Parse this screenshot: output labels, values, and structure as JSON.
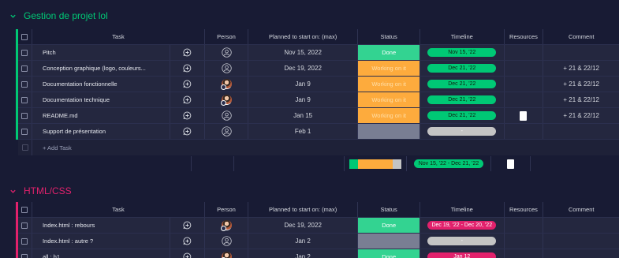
{
  "groups": [
    {
      "title": "Gestion de projet lol",
      "color": "#00c875",
      "headers": {
        "task": "Task",
        "person": "Person",
        "planned": "Planned to start on: (max)",
        "status": "Status",
        "timeline": "Timeline",
        "resources": "Resources",
        "comment": "Comment"
      },
      "rows": [
        {
          "task": "Pitch",
          "person": "empty",
          "planned": "Nov 15, 2022",
          "status": "Done",
          "status_kind": "done",
          "timeline": "Nov 15, '22",
          "timeline_kind": "green",
          "resource": false,
          "comment": ""
        },
        {
          "task": "Conception graphique (logo, couleurs...",
          "person": "empty",
          "planned": "Dec 19, 2022",
          "status": "Working on it",
          "status_kind": "work",
          "timeline": "Dec 21, '22",
          "timeline_kind": "green",
          "resource": false,
          "comment": "+ 21 & 22/12"
        },
        {
          "task": "Documentation fonctionnelle",
          "person": "photo",
          "planned": "Jan 9",
          "status": "Working on it",
          "status_kind": "work",
          "timeline": "Dec 21, '22",
          "timeline_kind": "green",
          "resource": false,
          "comment": "+ 21 & 22/12"
        },
        {
          "task": "Documentation technique",
          "person": "photo",
          "planned": "Jan 9",
          "status": "Working on it",
          "status_kind": "work",
          "timeline": "Dec 21, '22",
          "timeline_kind": "green",
          "resource": false,
          "comment": "+ 21 & 22/12"
        },
        {
          "task": "README.md",
          "person": "empty",
          "planned": "Jan 15",
          "status": "Working on it",
          "status_kind": "work",
          "timeline": "Dec 21, '22",
          "timeline_kind": "green",
          "resource": true,
          "comment": "+ 21 & 22/12"
        },
        {
          "task": "Support de présentation",
          "person": "empty",
          "planned": "Feb 1",
          "status": "",
          "status_kind": "empty",
          "timeline": "-",
          "timeline_kind": "grey",
          "resource": false,
          "comment": ""
        }
      ],
      "add_task": "+ Add Task",
      "summary_timeline": "Nov 15, '22 - Dec 21, '22",
      "summary_progress": {
        "done": 0.17,
        "work": 0.66,
        "empty": 0.17
      }
    },
    {
      "title": "HTML/CSS",
      "color": "#e2216c",
      "headers": {
        "task": "Task",
        "person": "Person",
        "planned": "Planned to start on: (max)",
        "status": "Status",
        "timeline": "Timeline",
        "resources": "Resources",
        "comment": "Comment"
      },
      "rows": [
        {
          "task": "Index.html : rebours",
          "person": "photo",
          "planned": "Dec 19, 2022",
          "status": "Done",
          "status_kind": "done",
          "timeline": "Dec 19, '22 - Dec 20, '22",
          "timeline_kind": "pink",
          "resource": false,
          "comment": ""
        },
        {
          "task": "Index.html : autre ?",
          "person": "empty",
          "planned": "Jan 2",
          "status": "",
          "status_kind": "empty",
          "timeline": "-",
          "timeline_kind": "grey",
          "resource": false,
          "comment": ""
        },
        {
          "task": "all : h1",
          "person": "photo",
          "planned": "Jan 2",
          "status": "Done",
          "status_kind": "done",
          "timeline": "Jan 12",
          "timeline_kind": "pink",
          "resource": false,
          "comment": ""
        }
      ]
    }
  ]
}
